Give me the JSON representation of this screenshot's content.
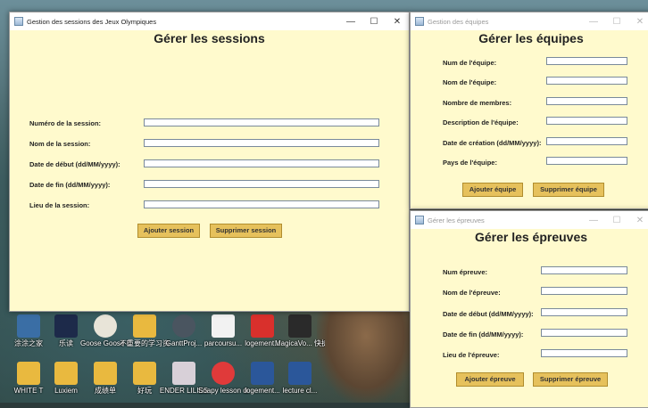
{
  "desktop": {
    "icons": [
      {
        "label": "涂涂之家"
      },
      {
        "label": "乐读"
      },
      {
        "label": "Goose Goose Duck"
      },
      {
        "label": "不重要的学习资料"
      },
      {
        "label": "GanttProj..."
      },
      {
        "label": "parcoursu..."
      },
      {
        "label": "logement..."
      },
      {
        "label": "MagicaVo... 快捷方式"
      },
      {
        "label": "WHITE T"
      },
      {
        "label": "Luxiem"
      },
      {
        "label": "成绩单"
      },
      {
        "label": "好玩"
      },
      {
        "label": "ENDER LILIES"
      },
      {
        "label": "Soapy lesson demo"
      },
      {
        "label": "logement..."
      },
      {
        "label": "lecture cl..."
      }
    ]
  },
  "sessions_window": {
    "title": "Gestion des sessions des Jeux Olympiques",
    "heading": "Gérer les sessions",
    "controls": {
      "minimize": "—",
      "maximize": "☐",
      "close": "✕"
    },
    "fields": [
      {
        "label": "Numéro de la session:",
        "value": ""
      },
      {
        "label": "Nom de la session:",
        "value": ""
      },
      {
        "label": "Date de début (dd/MM/yyyy):",
        "value": ""
      },
      {
        "label": "Date de fin (dd/MM/yyyy):",
        "value": ""
      },
      {
        "label": "Lieu de la session:",
        "value": ""
      }
    ],
    "add_button": "Ajouter session",
    "delete_button": "Supprimer session"
  },
  "equipes_window": {
    "title": "Gestion des équipes",
    "heading": "Gérer les équipes",
    "controls": {
      "minimize": "—",
      "maximize": "☐",
      "close": "✕"
    },
    "fields": [
      {
        "label": "Num de l'équipe:",
        "value": ""
      },
      {
        "label": "Nom de l'équipe:",
        "value": ""
      },
      {
        "label": "Nombre de membres:",
        "value": ""
      },
      {
        "label": "Description de l'équipe:",
        "value": ""
      },
      {
        "label": "Date de création (dd/MM/yyyy):",
        "value": ""
      },
      {
        "label": "Pays de l'équipe:",
        "value": ""
      }
    ],
    "add_button": "Ajouter équipe",
    "delete_button": "Supprimer équipe"
  },
  "epreuves_window": {
    "title": "Gérer les épreuves",
    "heading": "Gérer les épreuves",
    "controls": {
      "minimize": "—",
      "maximize": "☐",
      "close": "✕"
    },
    "fields": [
      {
        "label": "Num épreuve:",
        "value": ""
      },
      {
        "label": "Nom de l'épreuve:",
        "value": ""
      },
      {
        "label": "Date de début (dd/MM/yyyy):",
        "value": ""
      },
      {
        "label": "Date de fin (dd/MM/yyyy):",
        "value": ""
      },
      {
        "label": "Lieu de l'épreuve:",
        "value": ""
      }
    ],
    "add_button": "Ajouter épreuve",
    "delete_button": "Supprimer épreuve"
  }
}
